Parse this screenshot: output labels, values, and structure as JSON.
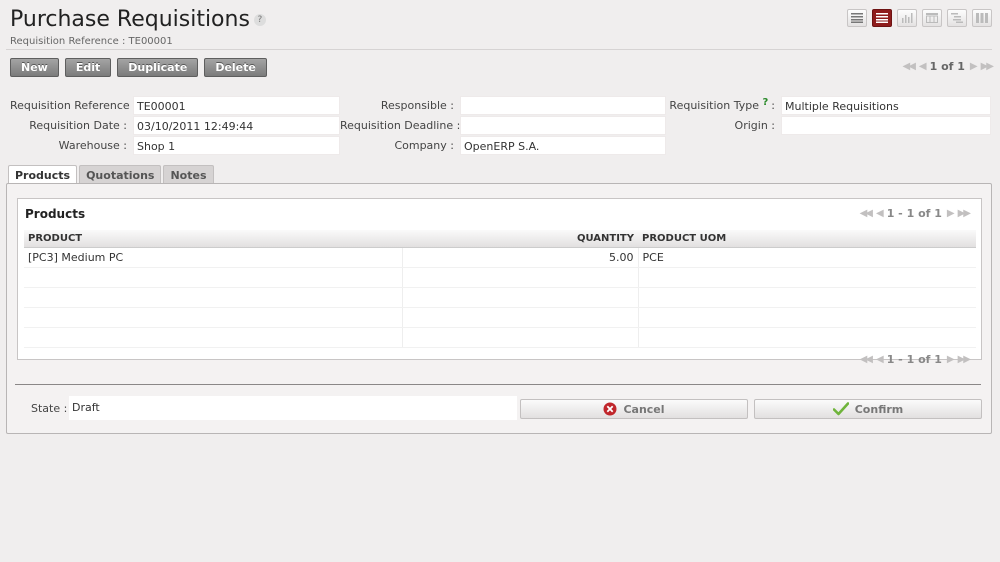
{
  "header": {
    "title": "Purchase Requisitions",
    "subtitle": "Requisition Reference : TE00001",
    "help_icon": "?"
  },
  "view_switcher": [
    {
      "icon": "list-view-icon",
      "active": false
    },
    {
      "icon": "form-view-icon",
      "active": true
    },
    {
      "icon": "graph-view-icon",
      "active": false
    },
    {
      "icon": "calendar-view-icon",
      "active": false
    },
    {
      "icon": "gantt-view-icon",
      "active": false
    },
    {
      "icon": "kanban-view-icon",
      "active": false
    }
  ],
  "toolbar": {
    "new_label": "New",
    "edit_label": "Edit",
    "duplicate_label": "Duplicate",
    "delete_label": "Delete"
  },
  "pager": {
    "text": "1 of 1"
  },
  "form": {
    "requisition_reference": {
      "label": "Requisition Reference :",
      "value": "TE00001"
    },
    "requisition_date": {
      "label": "Requisition Date :",
      "value": "03/10/2011 12:49:44"
    },
    "warehouse": {
      "label": "Warehouse :",
      "value": "Shop 1"
    },
    "responsible": {
      "label": "Responsible :",
      "value": ""
    },
    "requisition_deadline": {
      "label": "Requisition Deadline :",
      "value": ""
    },
    "company": {
      "label": "Company :",
      "value": "OpenERP S.A."
    },
    "requisition_type": {
      "label": "Requisition Type",
      "help": "?",
      "colon": ":",
      "value": "Multiple Requisitions"
    },
    "origin": {
      "label": "Origin :",
      "value": ""
    }
  },
  "tabs": [
    {
      "label": "Products",
      "active": true
    },
    {
      "label": "Quotations",
      "active": false
    },
    {
      "label": "Notes",
      "active": false
    }
  ],
  "products": {
    "title": "Products",
    "pager_text": "1 - 1 of 1",
    "columns": [
      "PRODUCT",
      "QUANTITY",
      "PRODUCT UOM"
    ],
    "rows": [
      [
        "[PC3] Medium PC",
        "5.00",
        "PCE"
      ]
    ]
  },
  "footer": {
    "state_label": "State :",
    "state_value": "Draft",
    "cancel_label": "Cancel",
    "confirm_label": "Confirm"
  },
  "colors": {
    "active_view": "#8e1c1c",
    "cancel_icon": "#c0262b",
    "confirm_icon": "#6fb43b"
  }
}
